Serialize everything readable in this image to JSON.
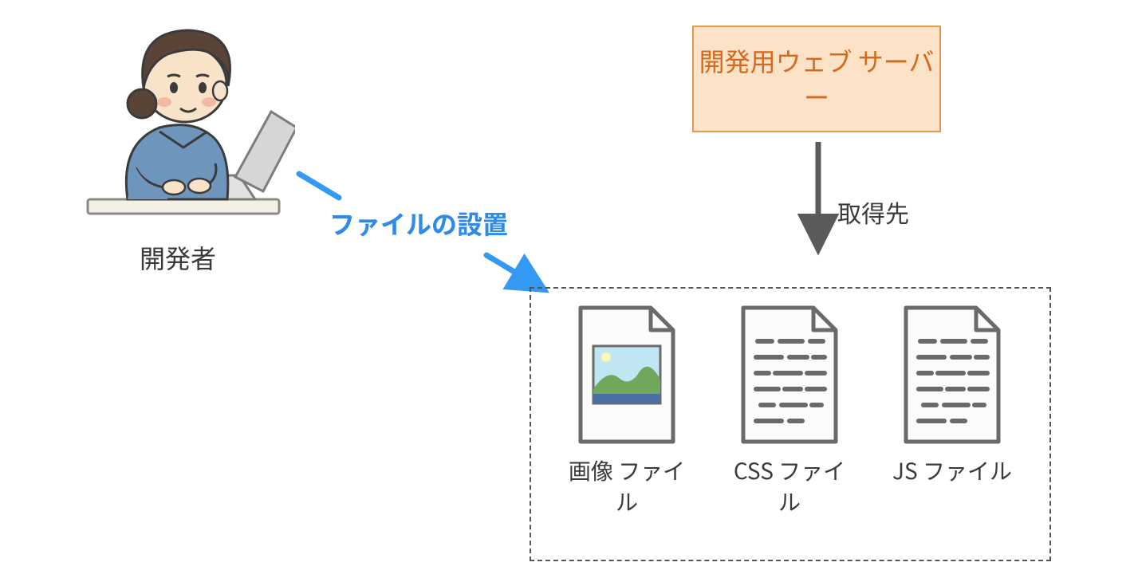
{
  "developer": {
    "label": "開発者"
  },
  "server": {
    "label": "開発用ウェブ\nサーバー"
  },
  "arrows": {
    "place_files": "ファイルの設置",
    "fetch_target": "取得先"
  },
  "files": {
    "image": {
      "label": "画像\nファイル"
    },
    "css": {
      "label": "CSS\nファイル"
    },
    "js": {
      "label": "JS\nファイル"
    }
  },
  "colors": {
    "arrow_blue": "#3399f2",
    "arrow_gray": "#5a5a5a",
    "server_fill": "#fce3c7",
    "server_border": "#e6984d",
    "server_text": "#d6691e",
    "doc_stroke": "#6a6a6a",
    "doc_fill": "#fcfcfa"
  }
}
